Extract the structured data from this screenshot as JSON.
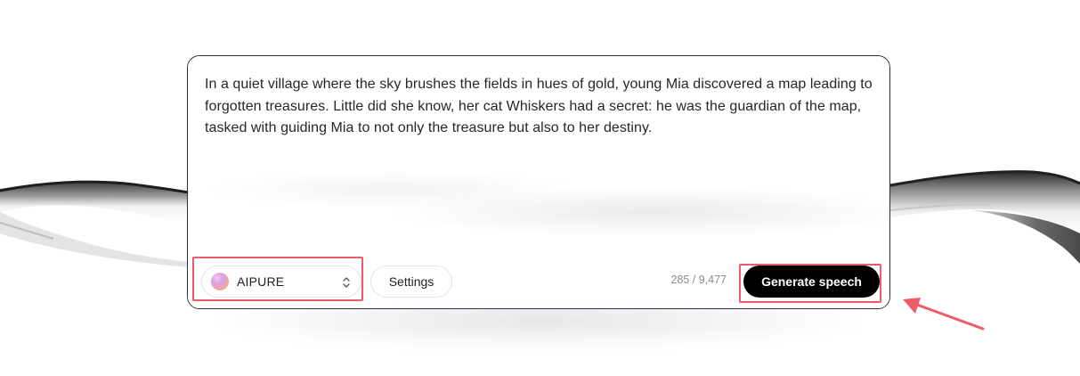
{
  "editor": {
    "text": "In a quiet village where the sky brushes the fields in hues of gold, young Mia discovered a map leading to forgotten treasures. Little did she know, her cat Whiskers had a secret: he was the guardian of the map, tasked with guiding Mia to not only the treasure but also to her destiny."
  },
  "toolbar": {
    "voice_label": "AIPURE",
    "settings_label": "Settings",
    "char_count": "285 / 9,477",
    "generate_label": "Generate speech"
  },
  "icons": {
    "voice": "voice-avatar-orb",
    "chevron": "chevron-up-down-icon",
    "annotation_arrow": "arrow-icon"
  },
  "colors": {
    "accent_button": "#000000",
    "highlight": "#ee5a68",
    "card_border": "#2a2f45"
  }
}
